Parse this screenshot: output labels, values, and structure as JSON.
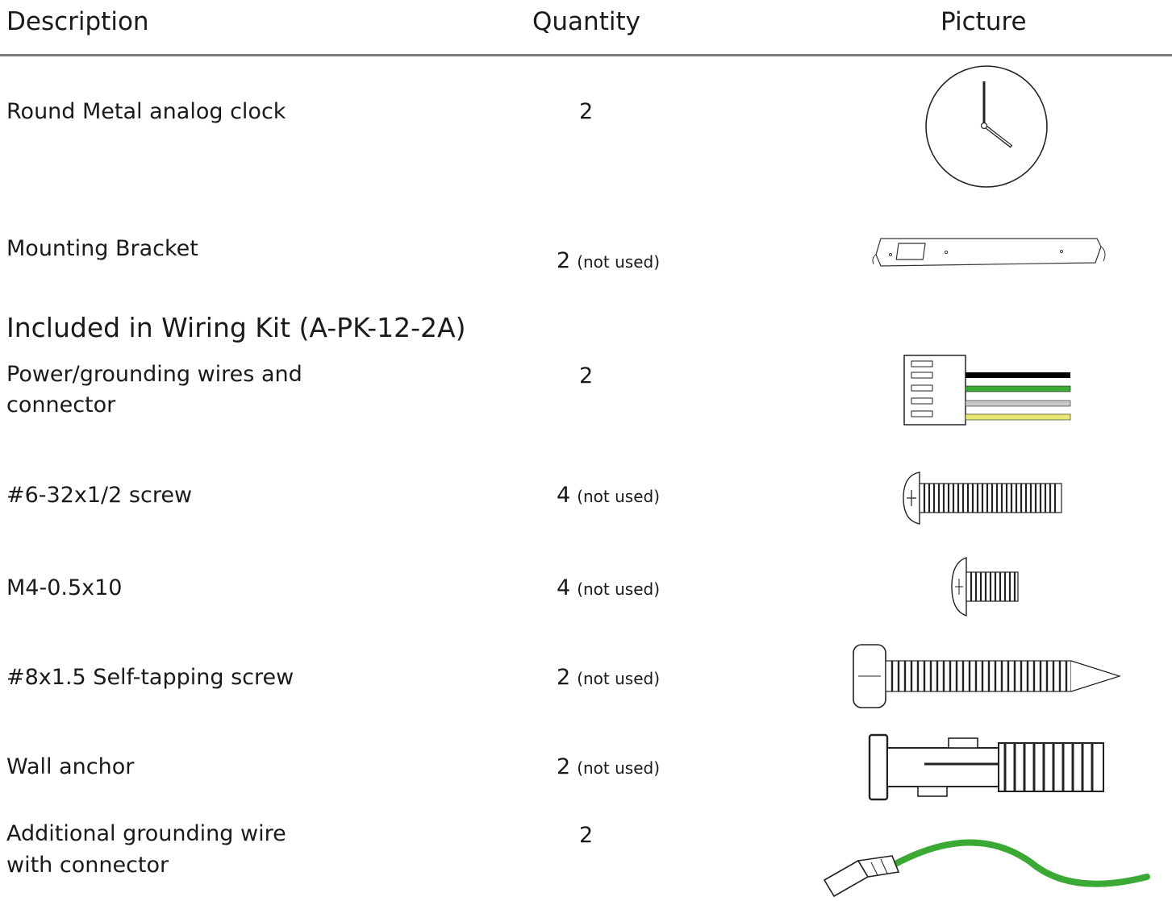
{
  "header": {
    "description": "Description",
    "quantity": "Quantity",
    "picture": "Picture"
  },
  "section_title": "Included in Wiring Kit (A-PK-12-2A)",
  "rows": [
    {
      "description": "Round Metal analog clock",
      "quantity": "2",
      "note": "",
      "picture": "clock-icon"
    },
    {
      "description": "Mounting Bracket",
      "quantity": "2",
      "note": "(not used)",
      "picture": "bracket-icon"
    },
    {
      "description_line1": "Power/grounding wires and",
      "description_line2": "connector",
      "quantity": "2",
      "note": "",
      "picture": "wire-connector-icon",
      "wire_colors": [
        "#000000",
        "#3aaa35",
        "#c8c8c8",
        "#e8e870"
      ]
    },
    {
      "description": "#6-32x1/2 screw",
      "quantity": "4",
      "note": "(not used)",
      "picture": "screw-icon"
    },
    {
      "description": "M4-0.5x10",
      "quantity": "4",
      "note": "(not used)",
      "picture": "short-screw-icon"
    },
    {
      "description": "#8x1.5 Self-tapping screw",
      "quantity": "2",
      "note": "(not used)",
      "picture": "self-tapping-screw-icon"
    },
    {
      "description": "Wall anchor",
      "quantity": "2",
      "note": "(not used)",
      "picture": "wall-anchor-icon"
    },
    {
      "description_line1": "Additional grounding wire",
      "description_line2": "with connector",
      "quantity": "2",
      "note": "",
      "picture": "grounding-wire-icon",
      "wire_color": "#3aaa35"
    }
  ]
}
